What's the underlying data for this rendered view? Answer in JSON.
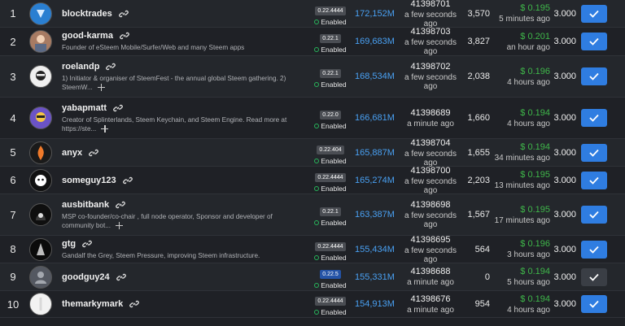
{
  "enabled_label": "Enabled",
  "more_glyph": "+",
  "rows": [
    {
      "rank": "1",
      "name": "blocktrades",
      "description": "",
      "version": "0.22.4444",
      "votes": "172,152M",
      "last_block": "41398701",
      "last_block_time": "a few seconds ago",
      "missed": "3,570",
      "price": "$ 0.195",
      "price_time": "5 minutes ago",
      "apr": "3.000",
      "voted": true
    },
    {
      "rank": "2",
      "name": "good-karma",
      "description": "Founder of eSteem Mobile/Surfer/Web and many Steem apps",
      "version": "0.22.1",
      "votes": "169,683M",
      "last_block": "41398703",
      "last_block_time": "a few seconds ago",
      "missed": "3,827",
      "price": "$ 0.201",
      "price_time": "an hour ago",
      "apr": "3.000",
      "voted": true
    },
    {
      "rank": "3",
      "name": "roelandp",
      "description": "1) Initiator & organiser of SteemFest - the annual global Steem gathering. 2) SteemW...",
      "version": "0.22.1",
      "votes": "168,534M",
      "last_block": "41398702",
      "last_block_time": "a few seconds ago",
      "missed": "2,038",
      "price": "$ 0.196",
      "price_time": "4 hours ago",
      "apr": "3.000",
      "voted": true
    },
    {
      "rank": "4",
      "name": "yabapmatt",
      "description": "Creator of Splinterlands, Steem Keychain, and Steem Engine. Read more at https://ste...",
      "version": "0.22.0",
      "votes": "166,681M",
      "last_block": "41398689",
      "last_block_time": "a minute ago",
      "missed": "1,660",
      "price": "$ 0.194",
      "price_time": "4 hours ago",
      "apr": "3.000",
      "voted": true
    },
    {
      "rank": "5",
      "name": "anyx",
      "description": "",
      "version": "0.22.404",
      "votes": "165,887M",
      "last_block": "41398704",
      "last_block_time": "a few seconds ago",
      "missed": "1,655",
      "price": "$ 0.194",
      "price_time": "34 minutes ago",
      "apr": "3.000",
      "voted": true
    },
    {
      "rank": "6",
      "name": "someguy123",
      "description": "",
      "version": "0.22.4444",
      "votes": "165,274M",
      "last_block": "41398700",
      "last_block_time": "a few seconds ago",
      "missed": "2,203",
      "price": "$ 0.195",
      "price_time": "13 minutes ago",
      "apr": "3.000",
      "voted": true
    },
    {
      "rank": "7",
      "name": "ausbitbank",
      "description": "MSP co-founder/co-chair , full node operator, Sponsor and developer of community bot...",
      "version": "0.22.1",
      "votes": "163,387M",
      "last_block": "41398698",
      "last_block_time": "a few seconds ago",
      "missed": "1,567",
      "price": "$ 0.195",
      "price_time": "17 minutes ago",
      "apr": "3.000",
      "voted": true
    },
    {
      "rank": "8",
      "name": "gtg",
      "description": "Gandalf the Grey, Steem Pressure, improving Steem infrastructure.",
      "version": "0.22.4444",
      "votes": "155,434M",
      "last_block": "41398695",
      "last_block_time": "a few seconds ago",
      "missed": "564",
      "price": "$ 0.196",
      "price_time": "3 hours ago",
      "apr": "3.000",
      "voted": true
    },
    {
      "rank": "9",
      "name": "goodguy24",
      "description": "",
      "version": "0.22.5",
      "votes": "155,331M",
      "last_block": "41398688",
      "last_block_time": "a minute ago",
      "missed": "0",
      "price": "$ 0.194",
      "price_time": "5 hours ago",
      "apr": "3.000",
      "voted": false
    },
    {
      "rank": "10",
      "name": "themarkymark",
      "description": "",
      "version": "0.22.4444",
      "votes": "154,913M",
      "last_block": "41398676",
      "last_block_time": "a minute ago",
      "missed": "954",
      "price": "$ 0.194",
      "price_time": "4 hours ago",
      "apr": "3.000",
      "voted": true
    }
  ]
}
